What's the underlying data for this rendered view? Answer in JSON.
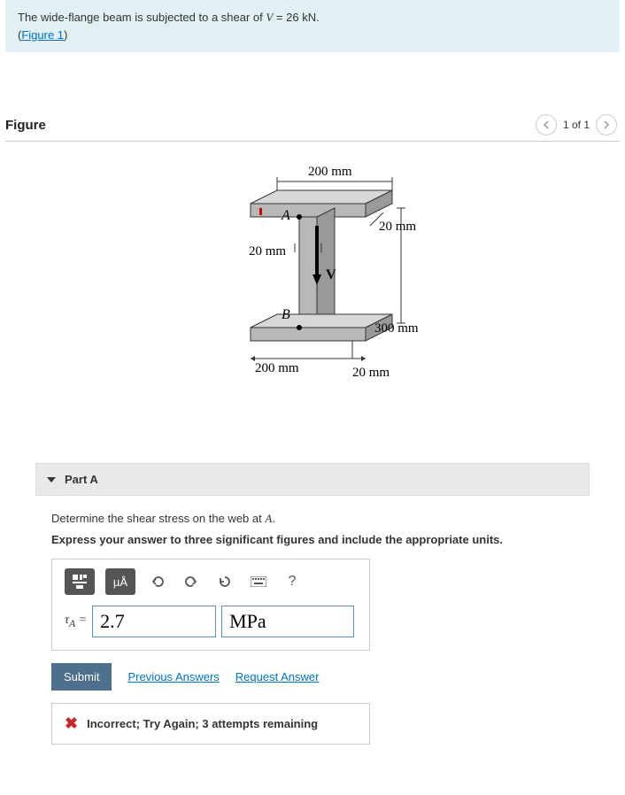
{
  "problem": {
    "text_pre": "The wide-flange beam is subjected to a shear of ",
    "var": "V",
    "equals": " = ",
    "value": "26 kN",
    "period": ".",
    "figure_link": "Figure 1"
  },
  "figure": {
    "title": "Figure",
    "nav": {
      "count": "1 of 1"
    },
    "labels": {
      "top_width": "200 mm",
      "top_flange_t": "20 mm",
      "web_t": "20 mm",
      "point_A": "A",
      "point_B": "B",
      "web_height": "300 mm",
      "bottom_width": "200 mm",
      "bottom_flange_t": "20 mm",
      "shear": "V"
    }
  },
  "part": {
    "title": "Part A",
    "instruction_pre": "Determine the shear stress on the web at ",
    "instruction_point": "A",
    "instruction_post": ".",
    "bold": "Express your answer to three significant figures and include the appropriate units.",
    "toolbar": {
      "units_btn": "µÅ",
      "help": "?"
    },
    "answer": {
      "label_pre": "τ",
      "label_sub": "A",
      "label_post": " = ",
      "value": "2.7",
      "unit": "MPa"
    },
    "actions": {
      "submit": "Submit",
      "previous": "Previous Answers",
      "request": "Request Answer"
    },
    "feedback": "Incorrect; Try Again; 3 attempts remaining"
  }
}
